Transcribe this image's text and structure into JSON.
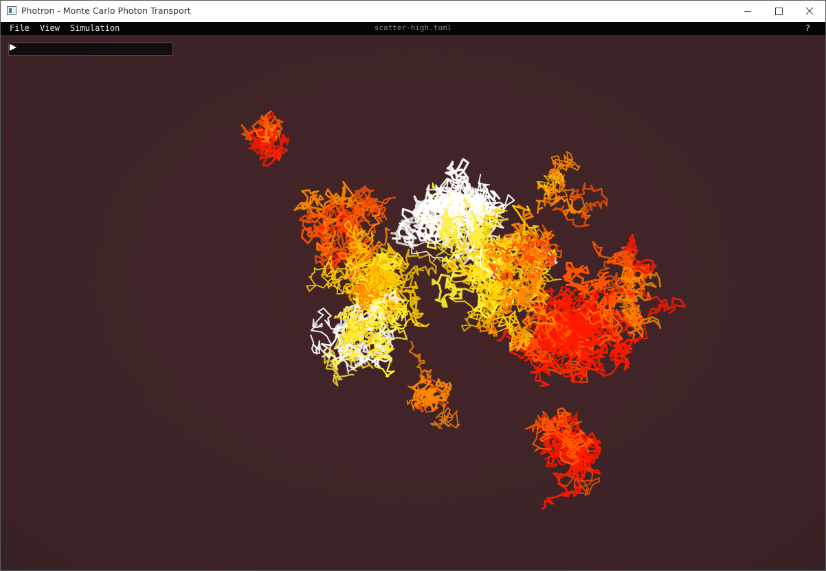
{
  "window": {
    "title": "Photron - Monte Carlo Photon Transport",
    "icon": "app-window-icon",
    "controls": {
      "minimize_icon": "minimize-icon",
      "maximize_icon": "maximize-icon",
      "close_icon": "close-icon"
    }
  },
  "menubar": {
    "items": [
      "File",
      "View",
      "Simulation"
    ],
    "file_name": "scatter-high.toml",
    "help": "?"
  },
  "playback": {
    "play_icon": "play-icon"
  },
  "scene": {
    "background": "#3f2427",
    "path_colors": [
      "#ff1a00",
      "#ff5500",
      "#ff8800",
      "#ffcc00",
      "#ffee33",
      "#ffffff"
    ]
  }
}
